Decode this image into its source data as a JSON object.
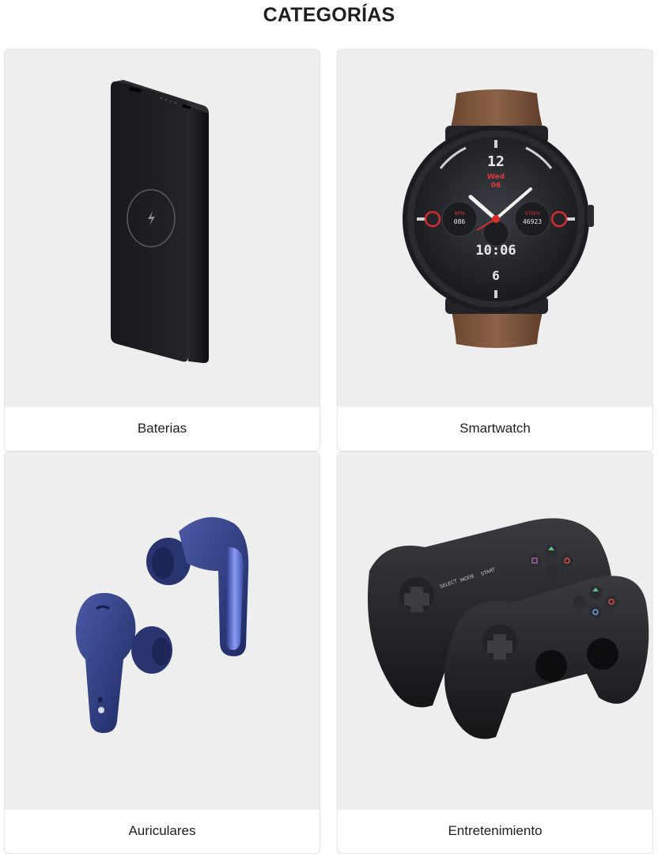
{
  "page": {
    "title": "CATEGORÍAS"
  },
  "categories": [
    {
      "label": "Baterias",
      "icon": "power-bank-image"
    },
    {
      "label": "Smartwatch",
      "icon": "smartwatch-image"
    },
    {
      "label": "Auriculares",
      "icon": "earbuds-image"
    },
    {
      "label": "Entretenimiento",
      "icon": "game-controllers-image"
    }
  ],
  "watch_face": {
    "hour_12": "12",
    "day": "Wed",
    "date": "06",
    "left_small_label": "BPM",
    "left_small_value": "086",
    "right_small_label": "STEPS",
    "right_small_value": "46923",
    "time": "10:06",
    "hour_6": "6"
  },
  "controller_labels": {
    "select": "SELECT",
    "mode": "MODE",
    "start": "START"
  }
}
